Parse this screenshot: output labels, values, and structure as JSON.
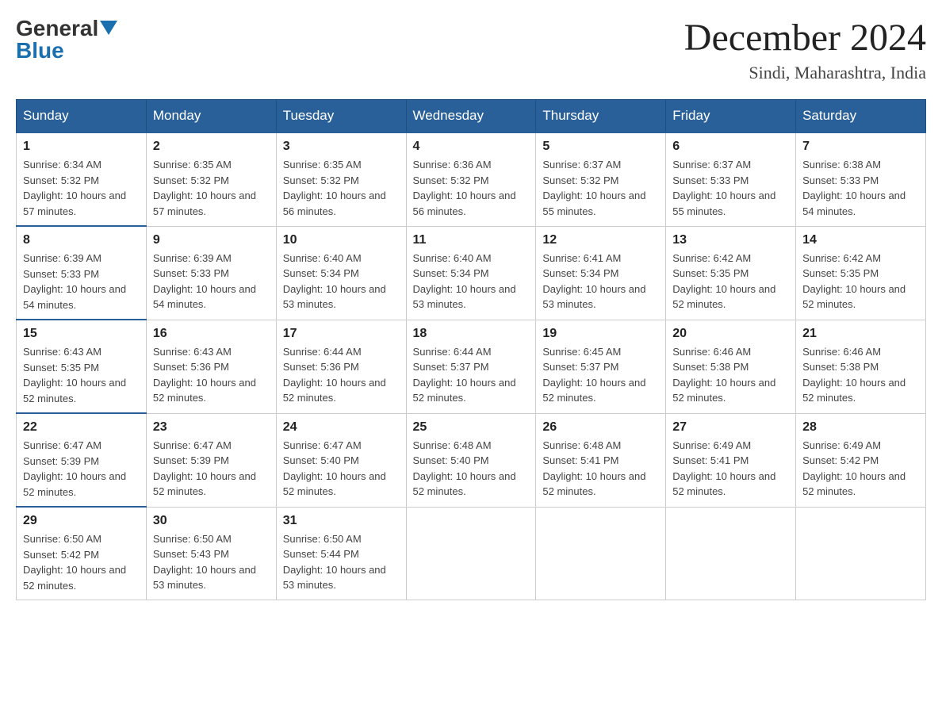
{
  "logo": {
    "general": "General",
    "blue": "Blue"
  },
  "title": {
    "month_year": "December 2024",
    "location": "Sindi, Maharashtra, India"
  },
  "headers": [
    "Sunday",
    "Monday",
    "Tuesday",
    "Wednesday",
    "Thursday",
    "Friday",
    "Saturday"
  ],
  "weeks": [
    [
      {
        "day": "1",
        "sunrise": "6:34 AM",
        "sunset": "5:32 PM",
        "daylight": "10 hours and 57 minutes."
      },
      {
        "day": "2",
        "sunrise": "6:35 AM",
        "sunset": "5:32 PM",
        "daylight": "10 hours and 57 minutes."
      },
      {
        "day": "3",
        "sunrise": "6:35 AM",
        "sunset": "5:32 PM",
        "daylight": "10 hours and 56 minutes."
      },
      {
        "day": "4",
        "sunrise": "6:36 AM",
        "sunset": "5:32 PM",
        "daylight": "10 hours and 56 minutes."
      },
      {
        "day": "5",
        "sunrise": "6:37 AM",
        "sunset": "5:32 PM",
        "daylight": "10 hours and 55 minutes."
      },
      {
        "day": "6",
        "sunrise": "6:37 AM",
        "sunset": "5:33 PM",
        "daylight": "10 hours and 55 minutes."
      },
      {
        "day": "7",
        "sunrise": "6:38 AM",
        "sunset": "5:33 PM",
        "daylight": "10 hours and 54 minutes."
      }
    ],
    [
      {
        "day": "8",
        "sunrise": "6:39 AM",
        "sunset": "5:33 PM",
        "daylight": "10 hours and 54 minutes."
      },
      {
        "day": "9",
        "sunrise": "6:39 AM",
        "sunset": "5:33 PM",
        "daylight": "10 hours and 54 minutes."
      },
      {
        "day": "10",
        "sunrise": "6:40 AM",
        "sunset": "5:34 PM",
        "daylight": "10 hours and 53 minutes."
      },
      {
        "day": "11",
        "sunrise": "6:40 AM",
        "sunset": "5:34 PM",
        "daylight": "10 hours and 53 minutes."
      },
      {
        "day": "12",
        "sunrise": "6:41 AM",
        "sunset": "5:34 PM",
        "daylight": "10 hours and 53 minutes."
      },
      {
        "day": "13",
        "sunrise": "6:42 AM",
        "sunset": "5:35 PM",
        "daylight": "10 hours and 52 minutes."
      },
      {
        "day": "14",
        "sunrise": "6:42 AM",
        "sunset": "5:35 PM",
        "daylight": "10 hours and 52 minutes."
      }
    ],
    [
      {
        "day": "15",
        "sunrise": "6:43 AM",
        "sunset": "5:35 PM",
        "daylight": "10 hours and 52 minutes."
      },
      {
        "day": "16",
        "sunrise": "6:43 AM",
        "sunset": "5:36 PM",
        "daylight": "10 hours and 52 minutes."
      },
      {
        "day": "17",
        "sunrise": "6:44 AM",
        "sunset": "5:36 PM",
        "daylight": "10 hours and 52 minutes."
      },
      {
        "day": "18",
        "sunrise": "6:44 AM",
        "sunset": "5:37 PM",
        "daylight": "10 hours and 52 minutes."
      },
      {
        "day": "19",
        "sunrise": "6:45 AM",
        "sunset": "5:37 PM",
        "daylight": "10 hours and 52 minutes."
      },
      {
        "day": "20",
        "sunrise": "6:46 AM",
        "sunset": "5:38 PM",
        "daylight": "10 hours and 52 minutes."
      },
      {
        "day": "21",
        "sunrise": "6:46 AM",
        "sunset": "5:38 PM",
        "daylight": "10 hours and 52 minutes."
      }
    ],
    [
      {
        "day": "22",
        "sunrise": "6:47 AM",
        "sunset": "5:39 PM",
        "daylight": "10 hours and 52 minutes."
      },
      {
        "day": "23",
        "sunrise": "6:47 AM",
        "sunset": "5:39 PM",
        "daylight": "10 hours and 52 minutes."
      },
      {
        "day": "24",
        "sunrise": "6:47 AM",
        "sunset": "5:40 PM",
        "daylight": "10 hours and 52 minutes."
      },
      {
        "day": "25",
        "sunrise": "6:48 AM",
        "sunset": "5:40 PM",
        "daylight": "10 hours and 52 minutes."
      },
      {
        "day": "26",
        "sunrise": "6:48 AM",
        "sunset": "5:41 PM",
        "daylight": "10 hours and 52 minutes."
      },
      {
        "day": "27",
        "sunrise": "6:49 AM",
        "sunset": "5:41 PM",
        "daylight": "10 hours and 52 minutes."
      },
      {
        "day": "28",
        "sunrise": "6:49 AM",
        "sunset": "5:42 PM",
        "daylight": "10 hours and 52 minutes."
      }
    ],
    [
      {
        "day": "29",
        "sunrise": "6:50 AM",
        "sunset": "5:42 PM",
        "daylight": "10 hours and 52 minutes."
      },
      {
        "day": "30",
        "sunrise": "6:50 AM",
        "sunset": "5:43 PM",
        "daylight": "10 hours and 53 minutes."
      },
      {
        "day": "31",
        "sunrise": "6:50 AM",
        "sunset": "5:44 PM",
        "daylight": "10 hours and 53 minutes."
      },
      null,
      null,
      null,
      null
    ]
  ]
}
